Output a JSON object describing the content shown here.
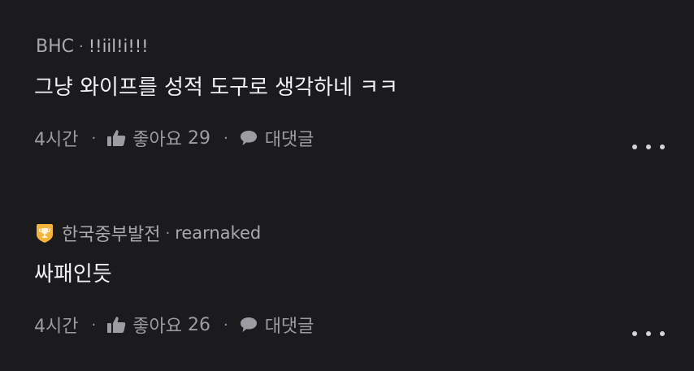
{
  "comments": [
    {
      "company": "BHC",
      "separator": "·",
      "nickname": "!!iil!i!!!",
      "text": "그냥 와이프를 성적 도구로 생각하네 ㅋㅋ",
      "time": "4시간",
      "like_label": "좋아요",
      "like_count": "29",
      "reply_label": "대댓글",
      "badge": null
    },
    {
      "company": "한국중부발전",
      "separator": "·",
      "nickname": "rearnaked",
      "text": "싸패인듯",
      "time": "4시간",
      "like_label": "좋아요",
      "like_count": "26",
      "reply_label": "대댓글",
      "badge": "trophy-icon"
    }
  ],
  "action_separator": "·",
  "colors": {
    "background": "#1b1b1d",
    "text_primary": "#f2f2f4",
    "text_secondary": "#9c9ca2",
    "badge_gold": "#f4b33a"
  }
}
